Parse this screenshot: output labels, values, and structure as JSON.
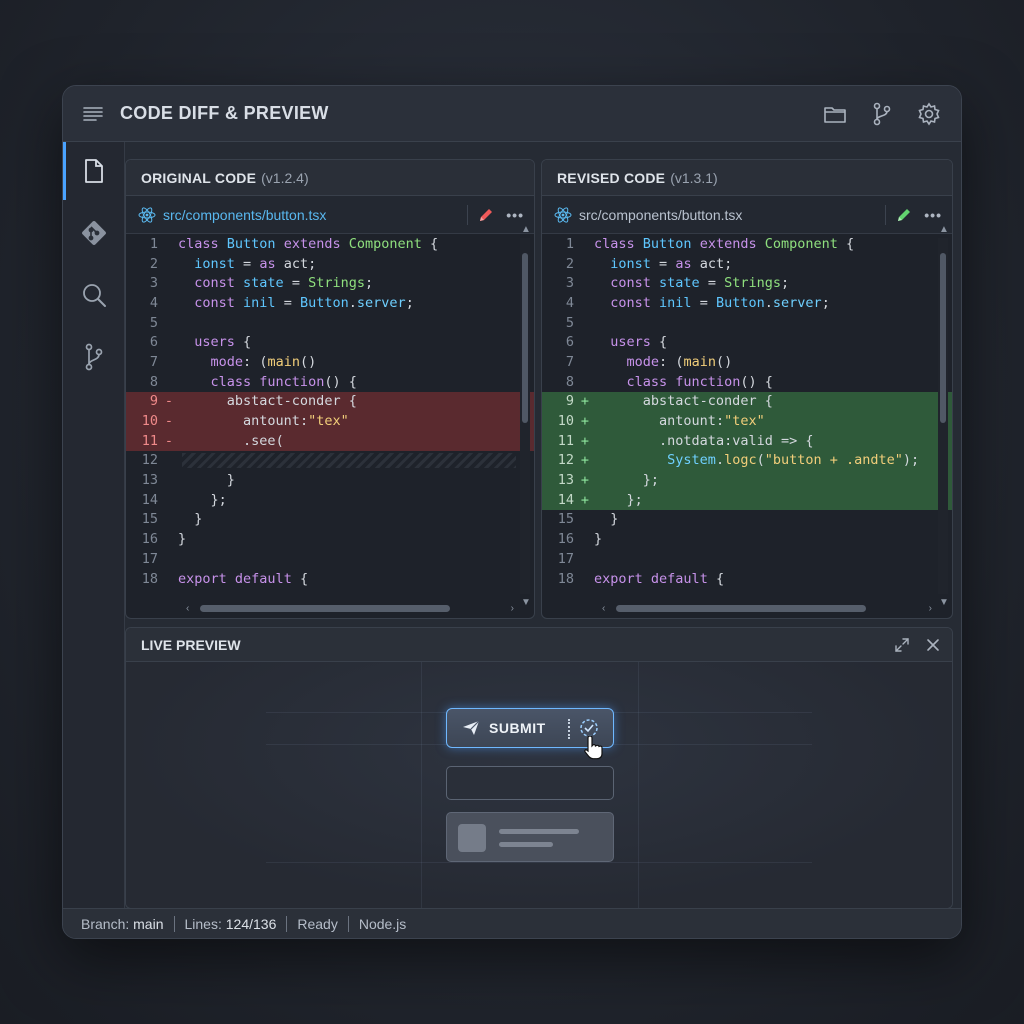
{
  "window": {
    "title": "CODE DIFF & PREVIEW"
  },
  "toolbar": {
    "icons": [
      "menu-icon",
      "folder-icon",
      "git-branch-icon",
      "settings-icon"
    ]
  },
  "sidebar": {
    "icons": [
      "file-icon",
      "git-icon",
      "search-icon",
      "source-control-icon",
      "settings-icon"
    ],
    "active": "file-icon"
  },
  "original": {
    "title": "ORIGINAL CODE",
    "version": "(v1.2.4)",
    "file": "src/components/button.tsx",
    "accent": "#f05a5a"
  },
  "revised": {
    "title": "REVISED CODE",
    "version": "(v1.3.1)",
    "file": "src/components/button.tsx",
    "accent": "#62d36f"
  },
  "more_label": "•••",
  "original_lines": [
    {
      "n": "1",
      "m": "",
      "t": "",
      "code": "class Button extends Component {"
    },
    {
      "n": "2",
      "m": "",
      "t": "",
      "code": "  ionst = as act;"
    },
    {
      "n": "3",
      "m": "",
      "t": "",
      "code": "  const state = Strings;"
    },
    {
      "n": "4",
      "m": "",
      "t": "",
      "code": "  const inil = Button.server;"
    },
    {
      "n": "5",
      "m": "",
      "t": "",
      "code": ""
    },
    {
      "n": "6",
      "m": "",
      "t": "",
      "code": "  users {"
    },
    {
      "n": "7",
      "m": "",
      "t": "",
      "code": "    mode: (main()"
    },
    {
      "n": "8",
      "m": "",
      "t": "",
      "code": "    class function() {"
    },
    {
      "n": "9",
      "m": "-",
      "t": "del",
      "code": "      abstact-conder {"
    },
    {
      "n": "10",
      "m": "-",
      "t": "del",
      "code": "        antount:\"tex\""
    },
    {
      "n": "11",
      "m": "-",
      "t": "del",
      "code": "        .see("
    },
    {
      "n": "12",
      "m": "",
      "t": "hatch",
      "code": ""
    },
    {
      "n": "13",
      "m": "",
      "t": "",
      "code": "      }"
    },
    {
      "n": "14",
      "m": "",
      "t": "",
      "code": "    };"
    },
    {
      "n": "15",
      "m": "",
      "t": "",
      "code": "  }"
    },
    {
      "n": "16",
      "m": "",
      "t": "",
      "code": "}"
    },
    {
      "n": "17",
      "m": "",
      "t": "",
      "code": ""
    },
    {
      "n": "18",
      "m": "",
      "t": "",
      "code": "export default {"
    }
  ],
  "revised_lines": [
    {
      "n": "1",
      "m": "",
      "t": "",
      "code": "class Button extends Component {"
    },
    {
      "n": "2",
      "m": "",
      "t": "",
      "code": "  ionst = as act;"
    },
    {
      "n": "3",
      "m": "",
      "t": "",
      "code": "  const state = Strings;"
    },
    {
      "n": "4",
      "m": "",
      "t": "",
      "code": "  const inil = Button.server;"
    },
    {
      "n": "5",
      "m": "",
      "t": "",
      "code": ""
    },
    {
      "n": "6",
      "m": "",
      "t": "",
      "code": "  users {"
    },
    {
      "n": "7",
      "m": "",
      "t": "",
      "code": "    mode: (main()"
    },
    {
      "n": "8",
      "m": "",
      "t": "",
      "code": "    class function() {"
    },
    {
      "n": "9",
      "m": "+",
      "t": "add",
      "code": "      abstact-conder {"
    },
    {
      "n": "10",
      "m": "+",
      "t": "add",
      "code": "        antount:\"tex\""
    },
    {
      "n": "11",
      "m": "+",
      "t": "add",
      "code": "        .notdata:valid => {"
    },
    {
      "n": "12",
      "m": "+",
      "t": "add",
      "code": "         System.logc(\"button + .andte\");"
    },
    {
      "n": "13",
      "m": "+",
      "t": "add",
      "code": "      };"
    },
    {
      "n": "14",
      "m": "+",
      "t": "add",
      "code": "    };"
    },
    {
      "n": "15",
      "m": "",
      "t": "",
      "code": "  }"
    },
    {
      "n": "16",
      "m": "",
      "t": "",
      "code": "}"
    },
    {
      "n": "17",
      "m": "",
      "t": "",
      "code": ""
    },
    {
      "n": "18",
      "m": "",
      "t": "",
      "code": "export default {"
    }
  ],
  "preview": {
    "title": "LIVE PREVIEW",
    "button_label": "SUBMIT"
  },
  "status": {
    "branch_label": "Branch:",
    "branch": "main",
    "lines_label": "Lines:",
    "lines": "124/136",
    "state": "Ready",
    "runtime": "Node.js"
  }
}
